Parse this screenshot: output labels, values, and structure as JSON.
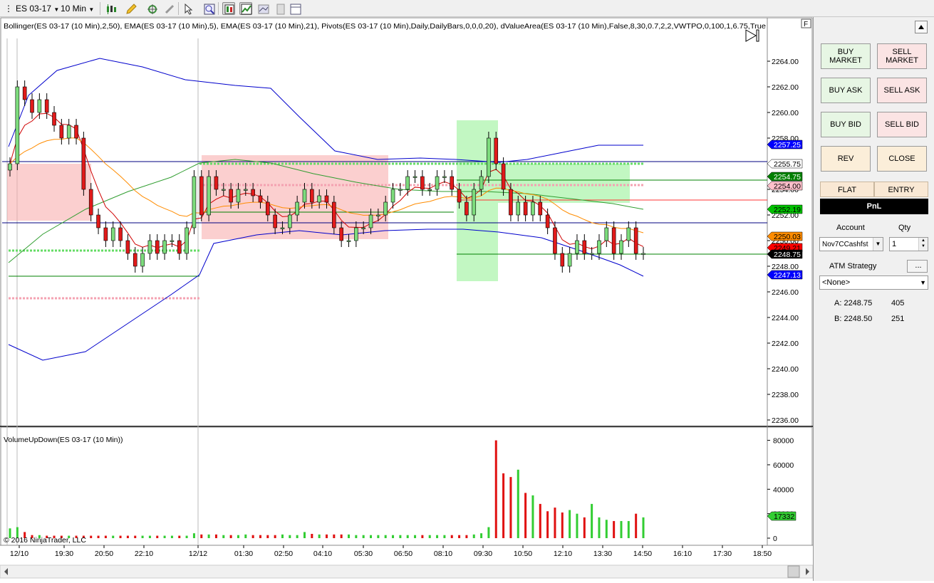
{
  "toolbar": {
    "instrument": "ES 03-17",
    "interval": "10 Min"
  },
  "chart": {
    "indicator_header": "Bollinger(ES 03-17 (10 Min),2,50), EMA(ES 03-17 (10 Min),5), EMA(ES 03-17 (10 Min),21), Pivots(ES 03-17 (10 Min),Daily,DailyBars,0,0,0,20), dValueArea(ES 03-17 (10 Min),False,8,30,0.7,2,2,VWTPO,0,100,1,6.75,True",
    "panel_f_label": "F",
    "volume_panel_label": "VolumeUpDown(ES 03-17 (10 Min))",
    "copyright": "© 2016 NinjaTrader, LLC",
    "price_ticks": [
      "2264.00",
      "2262.00",
      "2260.00",
      "2258.00",
      "2256.00",
      "2254.00",
      "2252.00",
      "2250.00",
      "2248.00",
      "2246.00",
      "2244.00",
      "2242.00",
      "2240.00",
      "2238.00",
      "2236.00"
    ],
    "volume_ticks": [
      "80000",
      "60000",
      "40000",
      "20000",
      "0"
    ],
    "time_labels": [
      "12/10",
      "19:30",
      "20:50",
      "22:10",
      "12/12",
      "01:30",
      "02:50",
      "04:10",
      "05:30",
      "06:50",
      "08:10",
      "09:30",
      "10:50",
      "12:10",
      "13:30",
      "14:50",
      "16:10",
      "17:30",
      "18:50"
    ],
    "price_badges": [
      {
        "label": "2257.25",
        "bg": "#0000ff",
        "fg": "#ffffff"
      },
      {
        "label": "2255.75",
        "bg": "#ffffff",
        "fg": "#000000"
      },
      {
        "label": "2254.75",
        "bg": "#008000",
        "fg": "#ffffff"
      },
      {
        "label": "2254.00",
        "bg": "#ffc0cb",
        "fg": "#000000"
      },
      {
        "label": "2252.19",
        "bg": "#00c000",
        "fg": "#000000"
      },
      {
        "label": "2250.03",
        "bg": "#ff8c00",
        "fg": "#000000"
      },
      {
        "label": "2249.21",
        "bg": "#ff0000",
        "fg": "#000000"
      },
      {
        "label": "2248.75",
        "bg": "#000000",
        "fg": "#ffffff"
      },
      {
        "label": "2247.13",
        "bg": "#0000ff",
        "fg": "#ffffff"
      }
    ],
    "volume_badge": {
      "label": "17332",
      "bg": "#32cd32",
      "fg": "#000000"
    }
  },
  "chart_data": {
    "type": "candlestick",
    "instrument": "ES 03-17",
    "interval": "10 Min",
    "ylim": [
      2235.5,
      2265.5
    ],
    "volume_ylim": [
      0,
      85000
    ],
    "closes": [
      2256,
      2262,
      2261,
      2260,
      2261,
      2260,
      2259,
      2258,
      2259,
      2258,
      2254,
      2252,
      2251,
      2250,
      2251,
      2250,
      2249,
      2248,
      2249,
      2250,
      2249,
      2250,
      2250,
      2249,
      2251,
      2255,
      2252,
      2255,
      2254,
      2254,
      2253,
      2254,
      2254,
      2253.5,
      2253,
      2252,
      2251,
      2251,
      2252,
      2253,
      2254,
      2253,
      2253.5,
      2253,
      2251,
      2250,
      2250,
      2251,
      2251,
      2252,
      2252,
      2253,
      2254,
      2254,
      2255,
      2255,
      2254,
      2254,
      2255,
      2255,
      2254,
      2253,
      2252,
      2254,
      2255,
      2258,
      2256,
      2254,
      2252,
      2253,
      2252,
      2253,
      2252,
      2251,
      2249,
      2248,
      2249,
      2250,
      2249,
      2249,
      2250,
      2251,
      2249,
      2250,
      2251,
      2249,
      2249
    ],
    "volumes": [
      8000,
      9000,
      5000,
      2500,
      2500,
      2000,
      2000,
      2000,
      2000,
      2000,
      2000,
      2000,
      2000,
      2000,
      2000,
      2000,
      2000,
      2000,
      2000,
      2000,
      2000,
      2000,
      2000,
      2000,
      2000,
      4000,
      3000,
      3000,
      3000,
      2500,
      2500,
      2500,
      3000,
      2500,
      2500,
      2500,
      2500,
      3000,
      2500,
      2500,
      5000,
      3500,
      3000,
      3000,
      3000,
      3000,
      3000,
      2500,
      2500,
      2500,
      2500,
      2500,
      2500,
      2500,
      2500,
      2500,
      2500,
      2500,
      2500,
      2500,
      2500,
      2500,
      2500,
      3000,
      4000,
      9000,
      80000,
      53000,
      50000,
      56000,
      37000,
      35000,
      28000,
      22000,
      25000,
      21000,
      23000,
      20000,
      17000,
      28000,
      17000,
      15000,
      14000,
      14000,
      14000,
      20000,
      17000,
      21000,
      15000,
      17332
    ],
    "levels": [
      {
        "price": 2257.25,
        "name": "Bollinger upper"
      },
      {
        "price": 2255.75,
        "name": "Pivot"
      },
      {
        "price": 2254.75,
        "name": "Value area"
      },
      {
        "price": 2254.0,
        "name": "dValueArea"
      },
      {
        "price": 2252.19,
        "name": "EMA 21"
      },
      {
        "price": 2250.03,
        "name": "EMA 5"
      },
      {
        "price": 2249.21,
        "name": "Bollinger mid"
      },
      {
        "price": 2248.75,
        "name": "Last"
      },
      {
        "price": 2247.13,
        "name": "Bollinger lower"
      }
    ],
    "ema_labels": [
      "EMA 5",
      "EMA 21"
    ],
    "colors": {
      "up": "#7ddc7d",
      "down": "#e11a1a",
      "bollinger": "#0000cc",
      "ema_fast": "#d00000",
      "ema_slow": "#ff8c00",
      "pivot": "#008000"
    }
  },
  "panel": {
    "buy_market": "BUY\nMARKET",
    "sell_market": "SELL\nMARKET",
    "buy_ask": "BUY ASK",
    "sell_ask": "SELL ASK",
    "buy_bid": "BUY BID",
    "sell_bid": "SELL BID",
    "rev": "REV",
    "close": "CLOSE",
    "flat": "FLAT",
    "entry": "ENTRY",
    "pnl": "PnL",
    "account_label": "Account",
    "qty_label": "Qty",
    "account_value": "Nov7CCashfst",
    "qty_value": "1",
    "atm_label": "ATM Strategy",
    "atm_button": "...",
    "atm_value": "<None>",
    "ask_label": "A: 2248.75",
    "ask_size": "405",
    "bid_label": "B: 2248.50",
    "bid_size": "251"
  }
}
